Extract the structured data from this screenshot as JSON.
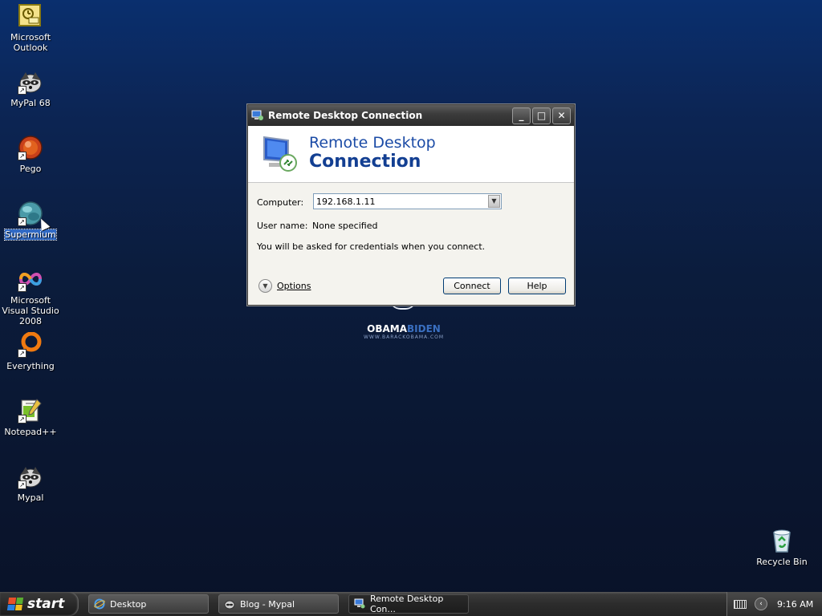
{
  "desktop": {
    "icons": [
      {
        "label": "Microsoft\nOutlook",
        "icon": "outlook-icon"
      },
      {
        "label": "MyPal 68",
        "icon": "mypal-icon"
      },
      {
        "label": "Pego",
        "icon": "pego-icon"
      },
      {
        "label": "Supermium",
        "icon": "supermium-icon"
      },
      {
        "label": "Microsoft Visual Studio 2008",
        "icon": "visual-studio-icon"
      },
      {
        "label": "Everything",
        "icon": "everything-icon"
      },
      {
        "label": "Notepad++",
        "icon": "notepadpp-icon"
      },
      {
        "label": "Mypal",
        "icon": "mypal-icon"
      },
      {
        "label": "Recycle Bin",
        "icon": "recycle-bin-icon"
      }
    ],
    "wallpaper": {
      "logo_main_a": "OBAMA",
      "logo_main_b": "BIDEN",
      "logo_sub": "WWW.BARACKOBAMA.COM"
    }
  },
  "dialog": {
    "title": "Remote Desktop Connection",
    "banner_line1": "Remote Desktop",
    "banner_line2": "Connection",
    "computer_label": "Computer:",
    "computer_value": "192.168.1.11",
    "username_label": "User name:",
    "username_value": "None specified",
    "info_text": "You will be asked for credentials when you connect.",
    "options_label": "Options",
    "connect_label": "Connect",
    "help_label": "Help",
    "minimize_glyph": "_",
    "maximize_glyph": "□",
    "close_glyph": "✕"
  },
  "taskbar": {
    "start_label": "start",
    "tasks": [
      {
        "label": "Desktop",
        "icon": "ie-icon"
      },
      {
        "label": "Blog - Mypal",
        "icon": "mypal-icon"
      },
      {
        "label": "Remote Desktop Con...",
        "icon": "rdc-icon"
      }
    ],
    "clock": "9:16 AM",
    "chevron_glyph": "‹"
  },
  "colors": {
    "accent": "#1b4ba6",
    "selection": "#316ac5"
  }
}
